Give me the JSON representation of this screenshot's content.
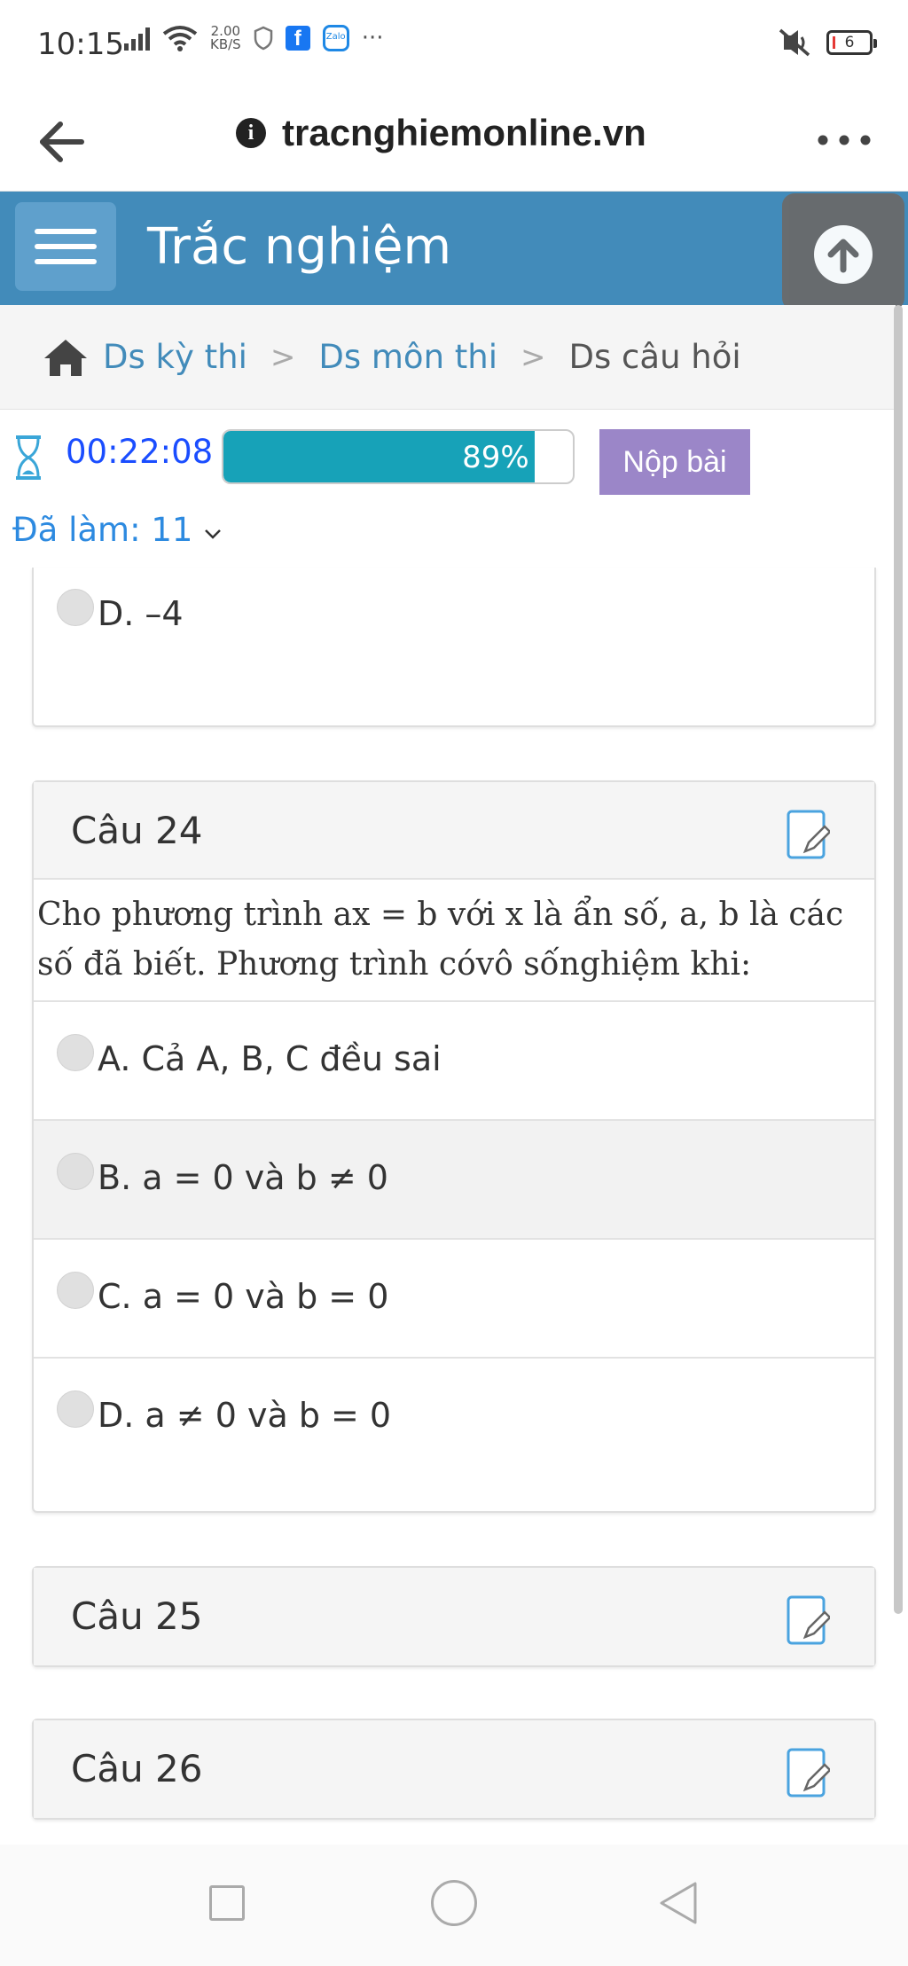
{
  "status_bar": {
    "time": "10:15",
    "net_speed_value": "2.00",
    "net_speed_unit": "KB/S",
    "more_dots": "···",
    "battery": "6",
    "icons": [
      "signal-icon",
      "wifi-icon",
      "shield-icon",
      "facebook-icon",
      "zalo-icon",
      "mute-icon",
      "battery-icon"
    ]
  },
  "browser": {
    "url": "tracnghiemonline.vn"
  },
  "header": {
    "title": "Trắc nghiệm"
  },
  "breadcrumb": {
    "items": [
      "Ds kỳ thi",
      "Ds môn thi"
    ],
    "current": "Ds câu hỏi",
    "separator": ">"
  },
  "exam": {
    "timer": "00:22:08",
    "progress_percent": 89,
    "progress_label": "89%",
    "submit_label": "Nộp bài",
    "done_label": "Đã làm: 11"
  },
  "previous_option": "D. –4",
  "questions": [
    {
      "title": "Câu 24",
      "text": "Cho phương trình ax = b với x là ẩn số, a, b là các số đã biết. Phương trình cóvô sốnghiệm khi:",
      "options": [
        "A. Cả A, B, C đều sai",
        "B. a = 0 và b ≠ 0",
        "C. a = 0 và b = 0",
        "D. a ≠ 0 và b = 0"
      ]
    },
    {
      "title": "Câu 25"
    },
    {
      "title": "Câu 26"
    }
  ],
  "colors": {
    "header": "#428bba",
    "progress": "#17a2b8",
    "submit": "#9b86c8",
    "link": "#428bba"
  }
}
